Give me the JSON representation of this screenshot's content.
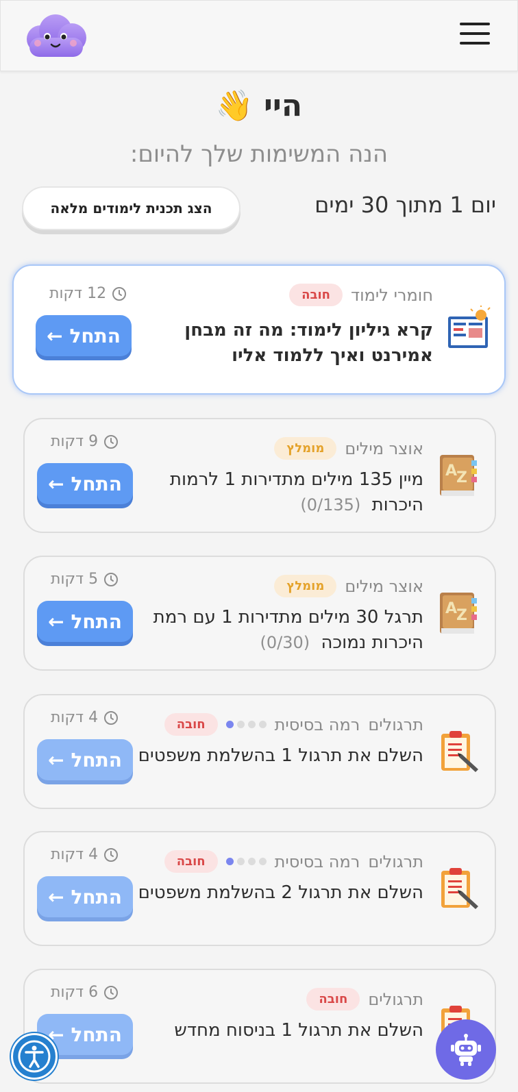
{
  "header": {
    "logo_icon": "cloud-mascot-icon",
    "menu_icon": "hamburger-menu-icon"
  },
  "greeting": {
    "text": "היי 👋"
  },
  "subtitle": "הנה המשימות שלך להיום:",
  "plan": {
    "day_label": "יום 1 מתוך 30 ימים",
    "button_label": "הצג תכנית לימודים מלאה"
  },
  "tasks": [
    {
      "category": "חומרי לימוד",
      "badge": "חובה",
      "badge_type": "required",
      "title": "קרא גיליון לימוד: מה זה מבחן אמירנט ואיך ללמוד אליו",
      "progress": "",
      "duration": "12 דקות",
      "start_label": "התחל",
      "icon": "study-sheet-icon",
      "level_label": "",
      "level_dots": []
    },
    {
      "category": "אוצר מילים",
      "badge": "מומלץ",
      "badge_type": "recommended",
      "title": "מיין 135 מילים מתדירות 1 לרמות היכרות",
      "progress": "(0/135)",
      "duration": "9 דקות",
      "start_label": "התחל",
      "icon": "az-dictionary-icon",
      "level_label": "",
      "level_dots": []
    },
    {
      "category": "אוצר מילים",
      "badge": "מומלץ",
      "badge_type": "recommended",
      "title": "תרגל 30 מילים מתדירות 1 עם רמת היכרות נמוכה",
      "progress": "(0/30)",
      "duration": "5 דקות",
      "start_label": "התחל",
      "icon": "az-dictionary-icon",
      "level_label": "",
      "level_dots": []
    },
    {
      "category": "תרגולים",
      "badge": "חובה",
      "badge_type": "required",
      "title": "השלם את תרגול 1 בהשלמת משפטים",
      "progress": "",
      "duration": "4 דקות",
      "start_label": "התחל",
      "icon": "clipboard-pencil-icon",
      "level_label": "רמה בסיסית",
      "level_dots": [
        true,
        false,
        false,
        false
      ]
    },
    {
      "category": "תרגולים",
      "badge": "חובה",
      "badge_type": "required",
      "title": "השלם את תרגול 2 בהשלמת משפטים",
      "progress": "",
      "duration": "4 דקות",
      "start_label": "התחל",
      "icon": "clipboard-pencil-icon",
      "level_label": "רמה בסיסית",
      "level_dots": [
        true,
        false,
        false,
        false
      ]
    },
    {
      "category": "תרגולים",
      "badge": "חובה",
      "badge_type": "required",
      "title": "השלם את תרגול 1 בניסוח מחדש",
      "progress": "",
      "duration": "6 דקות",
      "start_label": "התחל",
      "icon": "clipboard-pencil-icon",
      "level_label": "",
      "level_dots": []
    }
  ],
  "floating": {
    "accessibility_icon": "accessibility-icon",
    "bot_icon": "robot-icon"
  },
  "colors": {
    "primary_button": "#5e9af3",
    "required_badge": "#d94848",
    "recommended_badge": "#e4a22a",
    "bot": "#6f6ae6",
    "accessibility": "#2580cf"
  }
}
